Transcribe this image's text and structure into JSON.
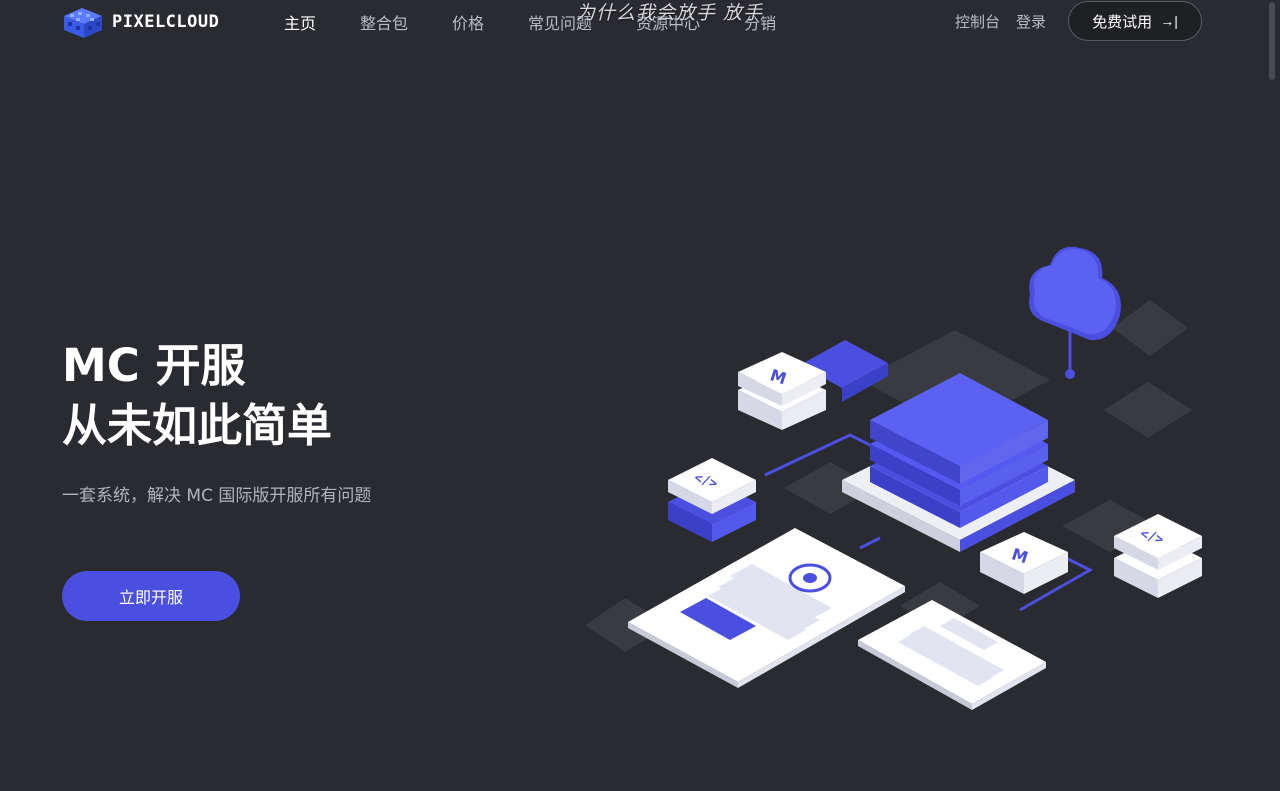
{
  "brand": {
    "name": "PIXELCLOUD"
  },
  "nav": {
    "items": [
      {
        "label": "主页",
        "active": true
      },
      {
        "label": "整合包"
      },
      {
        "label": "价格"
      },
      {
        "label": "常见问题"
      },
      {
        "label": "资源中心"
      },
      {
        "label": "分销"
      }
    ]
  },
  "overlay": {
    "text": "为什么我会放手 放手"
  },
  "header_right": {
    "console": "控制台",
    "login": "登录",
    "trial": "免费试用",
    "trial_icon": "arrow-to-right-icon"
  },
  "hero": {
    "title_line1": "MC 开服",
    "title_line2": "从未如此简单",
    "subtitle": "一套系统，解决 MC 国际版开服所有问题",
    "cta": "立即开服"
  },
  "illustration": {
    "code_glyph": "</>",
    "tile_glyph": "M"
  },
  "colors": {
    "background": "#2a2b30",
    "accent": "#4a4fe0",
    "text": "#ffffff",
    "muted": "#b0b3bb"
  }
}
